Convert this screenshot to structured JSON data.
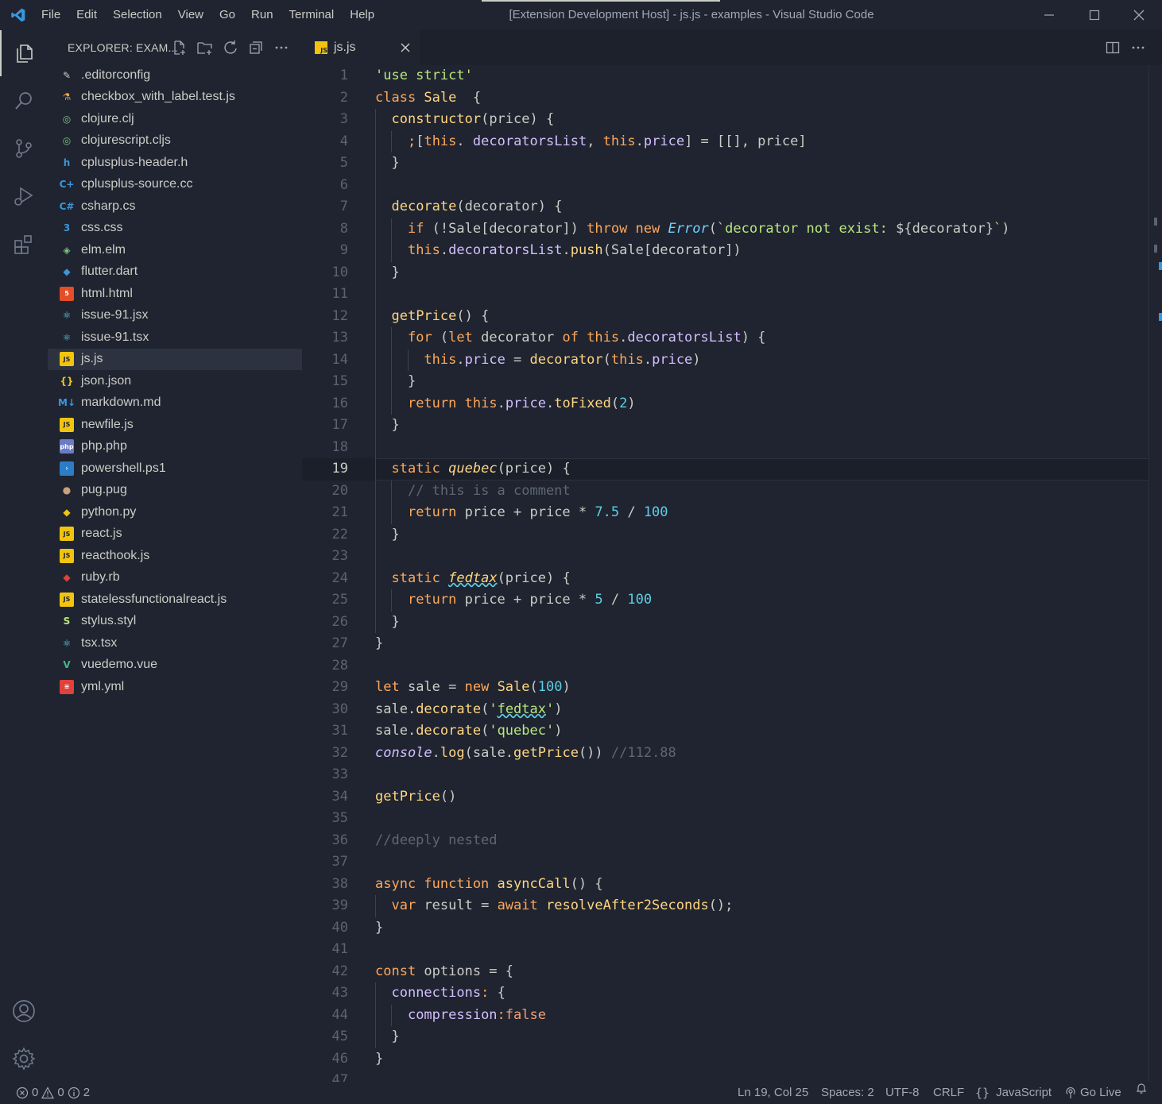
{
  "colors": {
    "background": "#1f2430",
    "foreground": "#cbccc6",
    "keyword": "#ffa759",
    "function": "#ffd580",
    "string": "#bae67e",
    "property": "#d4bfff",
    "number": "#5ccfe6",
    "comment": "#5c6773",
    "js_icon": "#f1c40f"
  },
  "titlebar": {
    "menu": [
      "File",
      "Edit",
      "Selection",
      "View",
      "Go",
      "Run",
      "Terminal",
      "Help"
    ],
    "title": "[Extension Development Host] - js.js - examples - Visual Studio Code"
  },
  "activitybar": {
    "icons": [
      "explorer-icon",
      "search-icon",
      "source-control-icon",
      "run-debug-icon",
      "extensions-icon",
      "account-icon",
      "settings-gear-icon"
    ]
  },
  "sidebar": {
    "title": "EXPLORER: EXAM...",
    "files": [
      {
        "name": ".editorconfig",
        "icon": "editorconfig-icon"
      },
      {
        "name": "checkbox_with_label.test.js",
        "icon": "test-flask-icon"
      },
      {
        "name": "clojure.clj",
        "icon": "clojure-icon"
      },
      {
        "name": "clojurescript.cljs",
        "icon": "clojure-icon"
      },
      {
        "name": "cplusplus-header.h",
        "icon": "h-icon"
      },
      {
        "name": "cplusplus-source.cc",
        "icon": "cpp-icon"
      },
      {
        "name": "csharp.cs",
        "icon": "csharp-icon"
      },
      {
        "name": "css.css",
        "icon": "css-icon"
      },
      {
        "name": "elm.elm",
        "icon": "elm-icon"
      },
      {
        "name": "flutter.dart",
        "icon": "dart-icon"
      },
      {
        "name": "html.html",
        "icon": "html-icon"
      },
      {
        "name": "issue-91.jsx",
        "icon": "react-icon"
      },
      {
        "name": "issue-91.tsx",
        "icon": "react-icon"
      },
      {
        "name": "js.js",
        "icon": "js-icon",
        "selected": true
      },
      {
        "name": "json.json",
        "icon": "json-icon"
      },
      {
        "name": "markdown.md",
        "icon": "markdown-icon"
      },
      {
        "name": "newfile.js",
        "icon": "js-icon"
      },
      {
        "name": "php.php",
        "icon": "php-icon"
      },
      {
        "name": "powershell.ps1",
        "icon": "powershell-icon"
      },
      {
        "name": "pug.pug",
        "icon": "pug-icon"
      },
      {
        "name": "python.py",
        "icon": "python-icon"
      },
      {
        "name": "react.js",
        "icon": "js-icon"
      },
      {
        "name": "reacthook.js",
        "icon": "js-icon"
      },
      {
        "name": "ruby.rb",
        "icon": "ruby-icon"
      },
      {
        "name": "statelessfunctionalreact.js",
        "icon": "js-icon"
      },
      {
        "name": "stylus.styl",
        "icon": "stylus-icon"
      },
      {
        "name": "tsx.tsx",
        "icon": "react-icon"
      },
      {
        "name": "vuedemo.vue",
        "icon": "vue-icon"
      },
      {
        "name": "yml.yml",
        "icon": "yaml-icon"
      }
    ]
  },
  "editor": {
    "tab": {
      "label": "js.js",
      "icon": "js-icon",
      "icon_text": "JS"
    },
    "current_line": 19,
    "lines": [
      {
        "n": "1",
        "t": [
          [
            "s",
            "'use strict'"
          ]
        ]
      },
      {
        "n": "2",
        "t": [
          [
            "k",
            "class "
          ],
          [
            "f",
            "Sale"
          ],
          [
            "",
            "  {"
          ]
        ]
      },
      {
        "n": "3",
        "t": [
          [
            "",
            "  "
          ],
          [
            "f",
            "constructor"
          ],
          [
            "",
            "(price) {"
          ]
        ]
      },
      {
        "n": "4",
        "t": [
          [
            "",
            "    "
          ],
          [
            "k",
            ";"
          ],
          [
            "",
            "["
          ],
          [
            "k",
            "this"
          ],
          [
            "",
            ". "
          ],
          [
            "p",
            "decoratorsList"
          ],
          [
            "",
            ", "
          ],
          [
            "k",
            "this"
          ],
          [
            "",
            "."
          ],
          [
            "p",
            "price"
          ],
          [
            "",
            "] = [[], price]"
          ]
        ]
      },
      {
        "n": "5",
        "t": [
          [
            "",
            "  }"
          ]
        ]
      },
      {
        "n": "6",
        "t": []
      },
      {
        "n": "7",
        "t": [
          [
            "",
            "  "
          ],
          [
            "f",
            "decorate"
          ],
          [
            "",
            "(decorator) {"
          ]
        ]
      },
      {
        "n": "8",
        "t": [
          [
            "",
            "    "
          ],
          [
            "k",
            "if"
          ],
          [
            "",
            " (!Sale[decorator]) "
          ],
          [
            "k",
            "throw new "
          ],
          [
            "t",
            "Error"
          ],
          [
            "",
            "(`"
          ],
          [
            "s",
            "decorator not exist: "
          ],
          [
            "",
            "${decorator}"
          ],
          [
            "s",
            "`"
          ],
          [
            "",
            ")"
          ]
        ]
      },
      {
        "n": "9",
        "t": [
          [
            "",
            "    "
          ],
          [
            "k",
            "this"
          ],
          [
            "",
            "."
          ],
          [
            "p",
            "decoratorsList"
          ],
          [
            "",
            "."
          ],
          [
            "f",
            "push"
          ],
          [
            "",
            "(Sale[decorator])"
          ]
        ]
      },
      {
        "n": "10",
        "t": [
          [
            "",
            "  }"
          ]
        ]
      },
      {
        "n": "11",
        "t": []
      },
      {
        "n": "12",
        "t": [
          [
            "",
            "  "
          ],
          [
            "f",
            "getPrice"
          ],
          [
            "",
            "() {"
          ]
        ]
      },
      {
        "n": "13",
        "t": [
          [
            "",
            "    "
          ],
          [
            "k",
            "for"
          ],
          [
            "",
            " ("
          ],
          [
            "k",
            "let"
          ],
          [
            "",
            " decorator "
          ],
          [
            "k",
            "of "
          ],
          [
            "k",
            "this"
          ],
          [
            "",
            "."
          ],
          [
            "p",
            "decoratorsList"
          ],
          [
            "",
            ") {"
          ]
        ]
      },
      {
        "n": "14",
        "t": [
          [
            "",
            "      "
          ],
          [
            "k",
            "this"
          ],
          [
            "",
            "."
          ],
          [
            "p",
            "price"
          ],
          [
            "",
            " = "
          ],
          [
            "f",
            "decorator"
          ],
          [
            "",
            "("
          ],
          [
            "k",
            "this"
          ],
          [
            "",
            "."
          ],
          [
            "p",
            "price"
          ],
          [
            "",
            ")"
          ]
        ]
      },
      {
        "n": "15",
        "t": [
          [
            "",
            "    }"
          ]
        ]
      },
      {
        "n": "16",
        "t": [
          [
            "",
            "    "
          ],
          [
            "k",
            "return "
          ],
          [
            "k",
            "this"
          ],
          [
            "",
            "."
          ],
          [
            "p",
            "price"
          ],
          [
            "",
            "."
          ],
          [
            "f",
            "toFixed"
          ],
          [
            "",
            "("
          ],
          [
            "n",
            "2"
          ],
          [
            "",
            ")"
          ]
        ]
      },
      {
        "n": "17",
        "t": [
          [
            "",
            "  }"
          ]
        ]
      },
      {
        "n": "18",
        "t": []
      },
      {
        "n": "19",
        "t": [
          [
            "",
            "  "
          ],
          [
            "k",
            "static "
          ],
          [
            "fi",
            "quebec"
          ],
          [
            "",
            "(price) {"
          ]
        ]
      },
      {
        "n": "20",
        "t": [
          [
            "",
            "    "
          ],
          [
            "c",
            "// this is a comment"
          ]
        ]
      },
      {
        "n": "21",
        "t": [
          [
            "",
            "    "
          ],
          [
            "k",
            "return"
          ],
          [
            "",
            " price + price * "
          ],
          [
            "n",
            "7.5"
          ],
          [
            "",
            " / "
          ],
          [
            "n",
            "100"
          ]
        ]
      },
      {
        "n": "22",
        "t": [
          [
            "",
            "  }"
          ]
        ]
      },
      {
        "n": "23",
        "t": []
      },
      {
        "n": "24",
        "t": [
          [
            "",
            "  "
          ],
          [
            "k",
            "static "
          ],
          [
            "fiw",
            "fedtax"
          ],
          [
            "",
            "(price) {"
          ]
        ]
      },
      {
        "n": "25",
        "t": [
          [
            "",
            "    "
          ],
          [
            "k",
            "return"
          ],
          [
            "",
            " price + price * "
          ],
          [
            "n",
            "5"
          ],
          [
            "",
            " / "
          ],
          [
            "n",
            "100"
          ]
        ]
      },
      {
        "n": "26",
        "t": [
          [
            "",
            "  }"
          ]
        ]
      },
      {
        "n": "27",
        "t": [
          [
            "",
            "}"
          ]
        ]
      },
      {
        "n": "28",
        "t": []
      },
      {
        "n": "29",
        "t": [
          [
            "k",
            "let"
          ],
          [
            "",
            " sale = "
          ],
          [
            "k",
            "new "
          ],
          [
            "f",
            "Sale"
          ],
          [
            "",
            "("
          ],
          [
            "n",
            "100"
          ],
          [
            "",
            ")"
          ]
        ]
      },
      {
        "n": "30",
        "t": [
          [
            "",
            "sale."
          ],
          [
            "f",
            "decorate"
          ],
          [
            "",
            "("
          ],
          [
            "s",
            "'"
          ],
          [
            "sw",
            "fedtax"
          ],
          [
            "s",
            "'"
          ],
          [
            "",
            ")"
          ]
        ]
      },
      {
        "n": "31",
        "t": [
          [
            "",
            "sale."
          ],
          [
            "f",
            "decorate"
          ],
          [
            "",
            "("
          ],
          [
            "s",
            "'quebec'"
          ],
          [
            "",
            ")"
          ]
        ]
      },
      {
        "n": "32",
        "t": [
          [
            "pi",
            "console"
          ],
          [
            "",
            "."
          ],
          [
            "f",
            "log"
          ],
          [
            "",
            "(sale."
          ],
          [
            "f",
            "getPrice"
          ],
          [
            "",
            "()) "
          ],
          [
            "c",
            "//112.88"
          ]
        ]
      },
      {
        "n": "33",
        "t": []
      },
      {
        "n": "34",
        "t": [
          [
            "f",
            "getPrice"
          ],
          [
            "",
            "()"
          ]
        ]
      },
      {
        "n": "35",
        "t": []
      },
      {
        "n": "36",
        "t": [
          [
            "c",
            "//deeply nested"
          ]
        ]
      },
      {
        "n": "37",
        "t": []
      },
      {
        "n": "38",
        "t": [
          [
            "k",
            "async function "
          ],
          [
            "f",
            "asyncCall"
          ],
          [
            "",
            "() {"
          ]
        ]
      },
      {
        "n": "39",
        "t": [
          [
            "",
            "  "
          ],
          [
            "k",
            "var"
          ],
          [
            "",
            " result = "
          ],
          [
            "k",
            "await "
          ],
          [
            "f",
            "resolveAfter2Seconds"
          ],
          [
            "",
            "();"
          ]
        ]
      },
      {
        "n": "40",
        "t": [
          [
            "",
            "}"
          ]
        ]
      },
      {
        "n": "41",
        "t": []
      },
      {
        "n": "42",
        "t": [
          [
            "k",
            "const"
          ],
          [
            "",
            " options = {"
          ]
        ]
      },
      {
        "n": "43",
        "t": [
          [
            "",
            "  "
          ],
          [
            "p",
            "connections"
          ],
          [
            "k",
            ":"
          ],
          [
            "",
            " {"
          ]
        ]
      },
      {
        "n": "44",
        "t": [
          [
            "",
            "    "
          ],
          [
            "p",
            "compression"
          ],
          [
            "k",
            ":"
          ],
          [
            " ",
            ""
          ],
          [
            "o",
            "false"
          ]
        ]
      },
      {
        "n": "45",
        "t": [
          [
            "",
            "  }"
          ]
        ]
      },
      {
        "n": "46",
        "t": [
          [
            "",
            "}"
          ]
        ]
      },
      {
        "n": "47",
        "t": []
      }
    ]
  },
  "statusbar": {
    "errors": "0",
    "warnings": "0",
    "info": "2",
    "position": "Ln 19, Col 25",
    "spaces": "Spaces: 2",
    "encoding": "UTF-8",
    "eol": "CRLF",
    "language": "JavaScript",
    "golive": "Go Live"
  }
}
